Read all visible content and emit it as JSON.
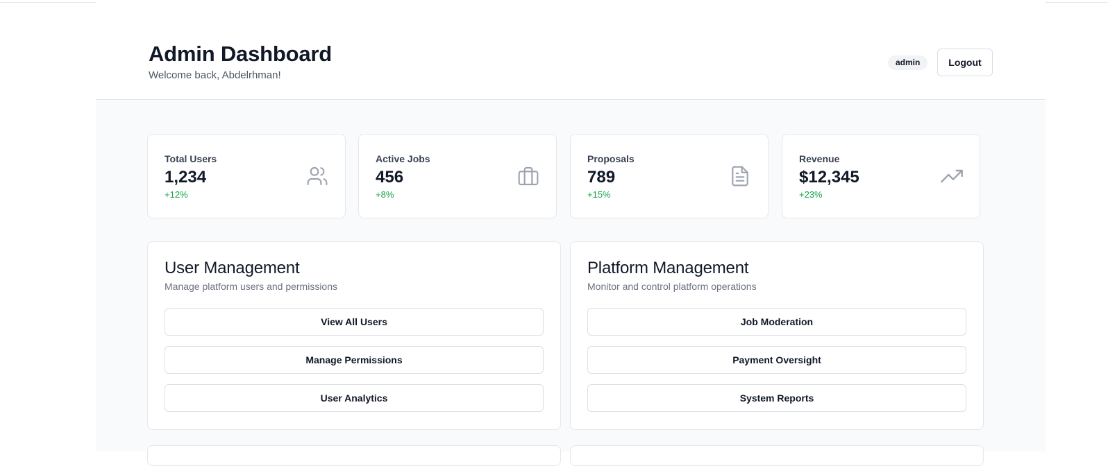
{
  "header": {
    "title": "Admin Dashboard",
    "subtitle": "Welcome back, Abdelrhman!",
    "role_badge": "admin",
    "logout_label": "Logout"
  },
  "stats": [
    {
      "label": "Total Users",
      "value": "1,234",
      "change": "+12%",
      "icon": "users-icon"
    },
    {
      "label": "Active Jobs",
      "value": "456",
      "change": "+8%",
      "icon": "briefcase-icon"
    },
    {
      "label": "Proposals",
      "value": "789",
      "change": "+15%",
      "icon": "document-icon"
    },
    {
      "label": "Revenue",
      "value": "$12,345",
      "change": "+23%",
      "icon": "trending-up-icon"
    }
  ],
  "panels": [
    {
      "title": "User Management",
      "description": "Manage platform users and permissions",
      "buttons": [
        "View All Users",
        "Manage Permissions",
        "User Analytics"
      ]
    },
    {
      "title": "Platform Management",
      "description": "Monitor and control platform operations",
      "buttons": [
        "Job Moderation",
        "Payment Oversight",
        "System Reports"
      ]
    }
  ],
  "colors": {
    "positive_change": "#16a34a",
    "icon_gray": "#9ca3af",
    "page_background": "#f9fafb",
    "border": "#e5e7eb"
  }
}
